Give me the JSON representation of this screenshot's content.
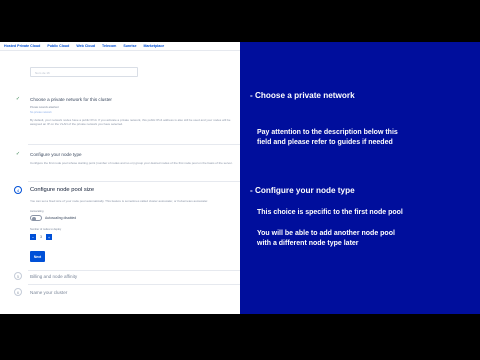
{
  "nav": {
    "items": [
      "Hosted Private Cloud",
      "Public Cloud",
      "Web Cloud",
      "Telecom",
      "Sunrise",
      "Marketplace"
    ]
  },
  "step_name": {
    "input_placeholder": "Nom de 16"
  },
  "step_network": {
    "title": "Choose a private network for this cluster",
    "sublabel": "Private network attached",
    "link": "No private network",
    "description": "By default, your network nodes have a public IPv4. If you activate a private network, this public IPv4 address is also still be used and your nodes will be assigned an IP on the VLAN of the private network you have selected."
  },
  "step_node_type": {
    "title": "Configure your node type",
    "description": "Configure the first node pool whose starting point (number of nodes and so on) group your desired nodes of the first node pool on the basis of the server."
  },
  "step_pool_size": {
    "number": "4",
    "title": "Configure node pool size",
    "description": "You can set a fixed size of your node pool automatically. This feature is sometimes called cluster autoscaler, or Kubernetes autoscaler.",
    "autoscaling_label": "Autoscaling",
    "autoscaling_state": "Autoscaling disabled",
    "nodes_label": "Number of nodes to deploy",
    "stepper_value": "3",
    "stepper_minus": "−",
    "stepper_plus": "+",
    "next_label": "Next"
  },
  "step_advanced": {
    "number": "5",
    "title": "Billing and node affinity"
  },
  "step_name_cluster": {
    "number": "6",
    "title": "Name your cluster"
  },
  "overlay": {
    "heading1": "- Choose a private network",
    "body1_line1": "Pay attention to the description below this",
    "body1_line2": "field and please refer to guides if needed",
    "heading2": "- Configure your node type",
    "body2_line1": "This choice is specific to the first node pool",
    "body2_line2": "You will be able to add another node pool",
    "body2_line3": "with a different node type later"
  },
  "colors": {
    "overlay_bg": "#000e9c",
    "accent": "#0050d7",
    "letterbox": "#000000"
  }
}
